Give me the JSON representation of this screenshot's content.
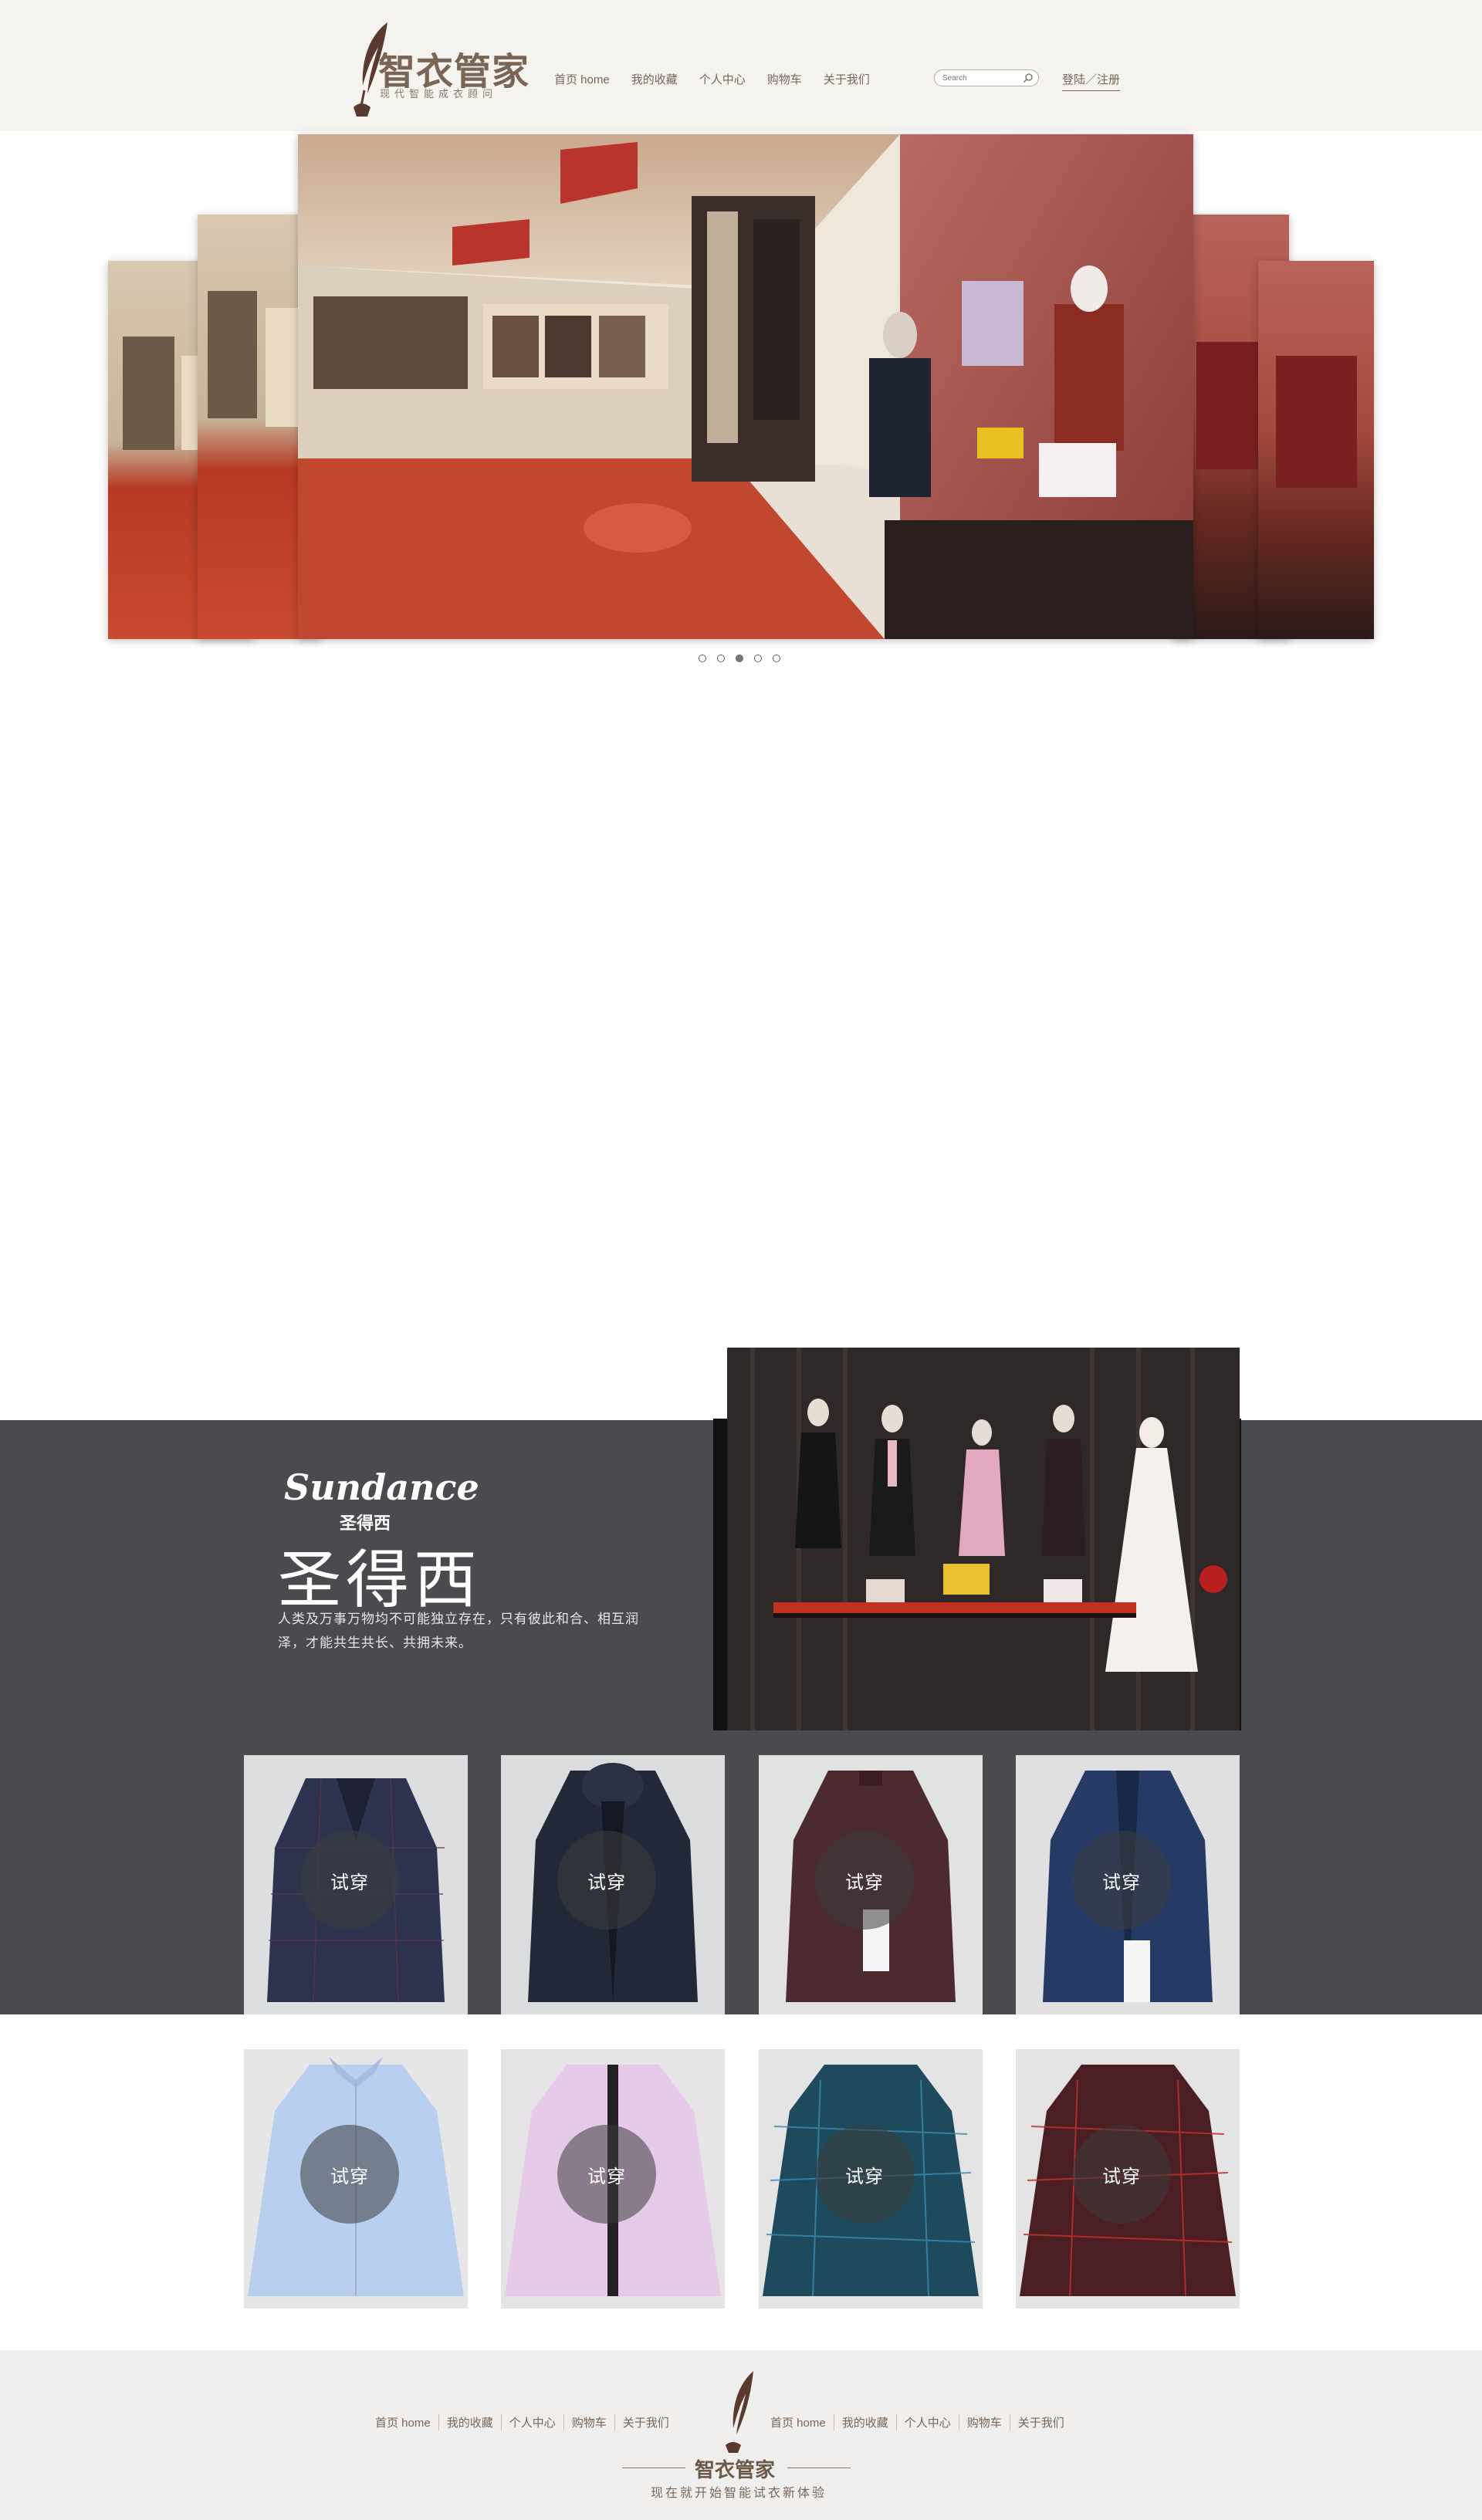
{
  "header": {
    "logo": {
      "title": "智衣管家",
      "tagline": "现代智能成衣顾问"
    },
    "nav": [
      {
        "label": "首页 home"
      },
      {
        "label": "我的收藏"
      },
      {
        "label": "个人中心"
      },
      {
        "label": "购物车"
      },
      {
        "label": "关于我们"
      }
    ],
    "search": {
      "placeholder": "Search"
    },
    "login_label": "登陆／注册"
  },
  "carousel": {
    "dots_count": 5,
    "active_index": 2
  },
  "brand": {
    "script_logo": "Sundance",
    "sub_logo": "圣得西",
    "name": "圣得西",
    "description": "人类及万事万物均不可能独立存在，只有彼此和合、相互润泽，才能共生共长、共拥未来。"
  },
  "products": {
    "try_on_label": "试穿",
    "row1": [
      {
        "name": "plaid-coat",
        "color": "#2e3450"
      },
      {
        "name": "hooded-coat",
        "color": "#232838"
      },
      {
        "name": "burgundy-jacket",
        "color": "#4b2a30"
      },
      {
        "name": "navy-jacket",
        "color": "#263a66"
      }
    ],
    "row2": [
      {
        "name": "light-blue-shirt",
        "color": "#b9cff0"
      },
      {
        "name": "pink-shirt",
        "color": "#e6cbe8"
      },
      {
        "name": "teal-pattern-shirt",
        "color": "#1d4a5c"
      },
      {
        "name": "red-pattern-shirt",
        "color": "#4a1e22"
      }
    ]
  },
  "footer": {
    "nav_left": [
      {
        "label": "首页 home"
      },
      {
        "label": "我的收藏"
      },
      {
        "label": "个人中心"
      },
      {
        "label": "购物车"
      },
      {
        "label": "关于我们"
      }
    ],
    "nav_right": [
      {
        "label": "首页 home"
      },
      {
        "label": "我的收藏"
      },
      {
        "label": "个人中心"
      },
      {
        "label": "购物车"
      },
      {
        "label": "关于我们"
      }
    ],
    "brand": "智衣管家",
    "slogan": "现在就开始智能试衣新体验"
  }
}
